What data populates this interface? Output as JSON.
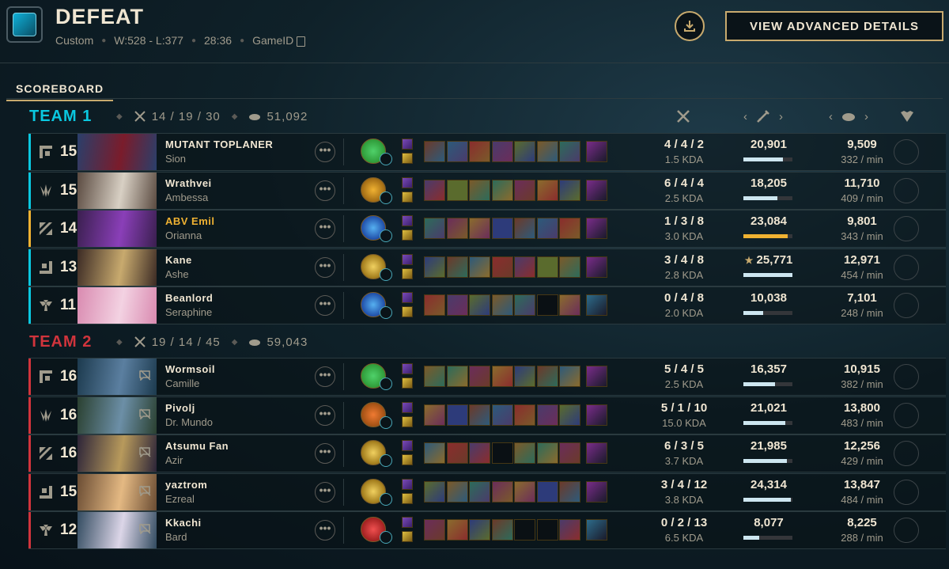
{
  "header": {
    "title": "DEFEAT",
    "queue": "Custom",
    "record": "W:528 - L:377",
    "duration": "28:36",
    "game_id_label": "GameID",
    "advanced_button": "VIEW ADVANCED DETAILS",
    "download_icon": "download-icon",
    "copy_icon": "copy-icon"
  },
  "tabs": {
    "scoreboard": "SCOREBOARD"
  },
  "colors": {
    "gold": "#c8aa6e",
    "team1": "#0ac8e0",
    "team2": "#d1343c",
    "damage_bar": "#cde6f0",
    "highlight_bar": "#f0b232"
  },
  "team1": {
    "name": "TEAM 1",
    "kda": "14 / 19 / 30",
    "gold": "51,092",
    "players": [
      {
        "level": "15",
        "name": "MUTANT TOPLANER",
        "champion": "Sion",
        "kda": "4 / 4 / 2",
        "kda_ratio": "1.5 KDA",
        "damage": "20,901",
        "damage_fraction": 0.8,
        "gold": "9,509",
        "gpm": "332 / min",
        "role": "top",
        "highlight": false
      },
      {
        "level": "15",
        "name": "Wrathvei",
        "champion": "Ambessa",
        "kda": "6 / 4 / 4",
        "kda_ratio": "2.5 KDA",
        "damage": "18,205",
        "damage_fraction": 0.7,
        "gold": "11,710",
        "gpm": "409 / min",
        "role": "jungle",
        "highlight": false
      },
      {
        "level": "14",
        "name": "ABV Emil",
        "champion": "Orianna",
        "kda": "1 / 3 / 8",
        "kda_ratio": "3.0 KDA",
        "damage": "23,084",
        "damage_fraction": 0.9,
        "gold": "9,801",
        "gpm": "343 / min",
        "role": "mid",
        "highlight": true
      },
      {
        "level": "13",
        "name": "Kane",
        "champion": "Ashe",
        "kda": "3 / 4 / 8",
        "kda_ratio": "2.8 KDA",
        "damage": "25,771",
        "damage_fraction": 1.0,
        "gold": "12,971",
        "gpm": "454 / min",
        "role": "bot",
        "highlight": false,
        "top_damage": true
      },
      {
        "level": "11",
        "name": "Beanlord",
        "champion": "Seraphine",
        "kda": "0 / 4 / 8",
        "kda_ratio": "2.0 KDA",
        "damage": "10,038",
        "damage_fraction": 0.4,
        "gold": "7,101",
        "gpm": "248 / min",
        "role": "support",
        "highlight": false
      }
    ]
  },
  "team2": {
    "name": "TEAM 2",
    "kda": "19 / 14 / 45",
    "gold": "59,043",
    "players": [
      {
        "level": "16",
        "name": "Wormsoil",
        "champion": "Camille",
        "kda": "5 / 4 / 5",
        "kda_ratio": "2.5 KDA",
        "damage": "16,357",
        "damage_fraction": 0.65,
        "gold": "10,915",
        "gpm": "382 / min",
        "role": "top"
      },
      {
        "level": "16",
        "name": "Pivolj",
        "champion": "Dr. Mundo",
        "kda": "5 / 1 / 10",
        "kda_ratio": "15.0 KDA",
        "damage": "21,021",
        "damage_fraction": 0.85,
        "gold": "13,800",
        "gpm": "483 / min",
        "role": "jungle"
      },
      {
        "level": "16",
        "name": "Atsumu Fan",
        "champion": "Azir",
        "kda": "6 / 3 / 5",
        "kda_ratio": "3.7 KDA",
        "damage": "21,985",
        "damage_fraction": 0.88,
        "gold": "12,256",
        "gpm": "429 / min",
        "role": "mid"
      },
      {
        "level": "15",
        "name": "yaztrom",
        "champion": "Ezreal",
        "kda": "3 / 4 / 12",
        "kda_ratio": "3.8 KDA",
        "damage": "24,314",
        "damage_fraction": 0.97,
        "gold": "13,847",
        "gpm": "484 / min",
        "role": "bot"
      },
      {
        "level": "12",
        "name": "Kkachi",
        "champion": "Bard",
        "kda": "0 / 2 / 13",
        "kda_ratio": "6.5 KDA",
        "damage": "8,077",
        "damage_fraction": 0.32,
        "gold": "8,225",
        "gpm": "288 / min",
        "role": "support"
      }
    ]
  },
  "ui": {
    "more_glyph": "•••",
    "muted_icon": "muted-icon",
    "star": "★"
  }
}
